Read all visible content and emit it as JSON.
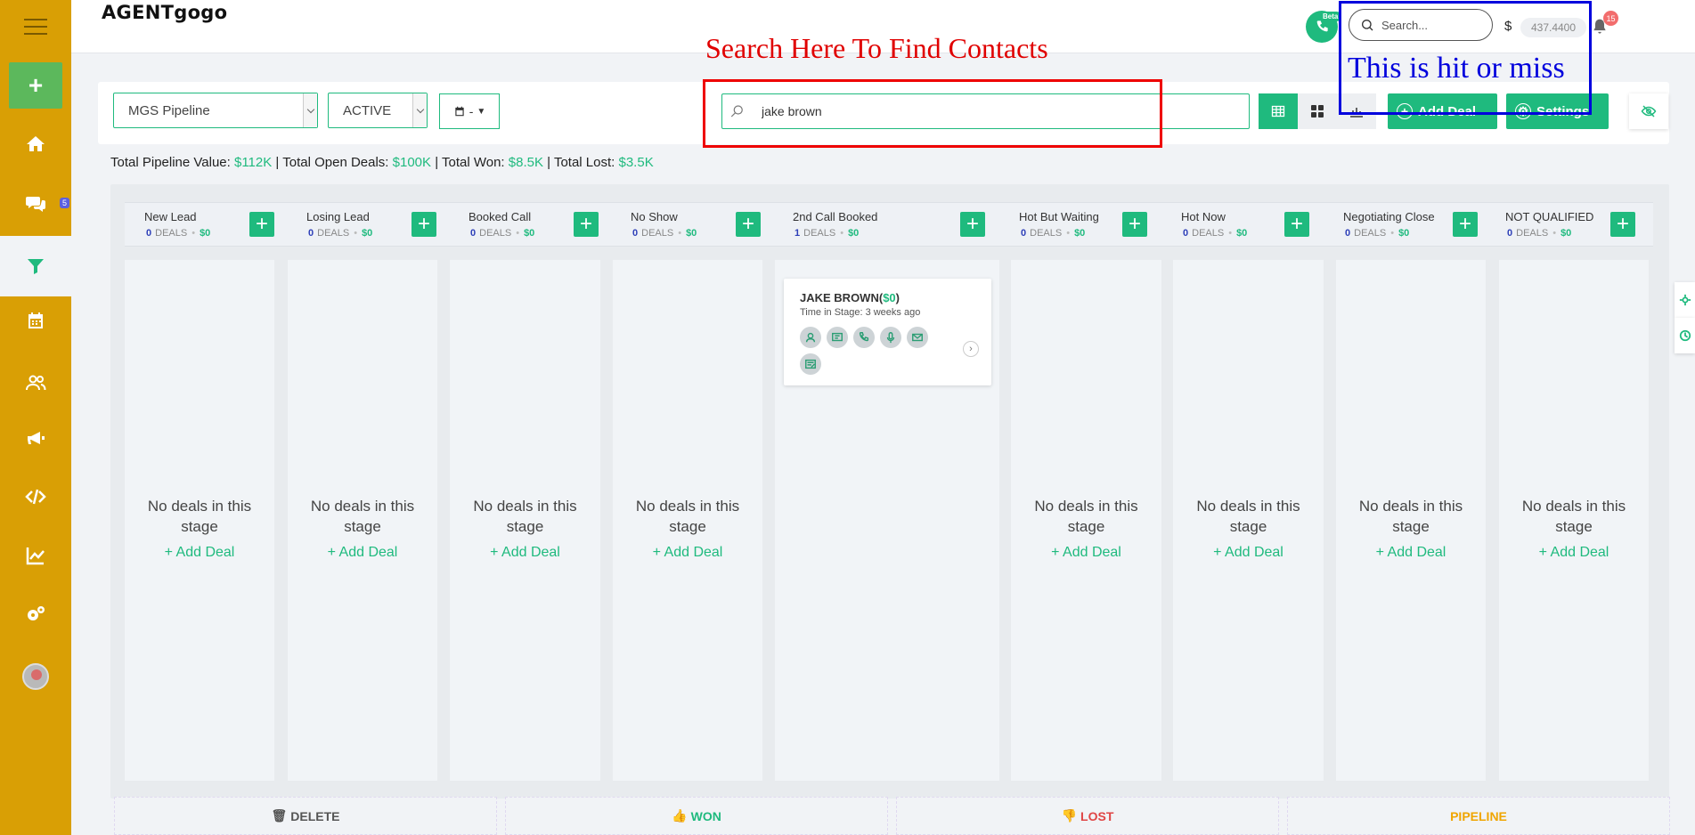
{
  "app": {
    "logo": "AGENTgogo"
  },
  "sidebar": {
    "items": [
      {
        "name": "menu",
        "icon": "hamburger-icon"
      },
      {
        "name": "add",
        "icon": "plus-icon",
        "label": "+"
      },
      {
        "name": "home",
        "icon": "home-icon"
      },
      {
        "name": "conversations",
        "icon": "chat-icon",
        "badge": "5"
      },
      {
        "name": "opportunities",
        "icon": "filter-icon",
        "active": true
      },
      {
        "name": "calendar",
        "icon": "calendar-icon"
      },
      {
        "name": "contacts",
        "icon": "users-icon"
      },
      {
        "name": "marketing",
        "icon": "megaphone-icon"
      },
      {
        "name": "sites",
        "icon": "code-icon"
      },
      {
        "name": "reporting",
        "icon": "chart-icon"
      },
      {
        "name": "settings",
        "icon": "gears-icon"
      },
      {
        "name": "profile",
        "icon": "avatar-icon"
      }
    ]
  },
  "header": {
    "phone_beta": "Beta",
    "search_placeholder": "Search...",
    "currency": "$",
    "balance": "437.4400",
    "notification_count": "15"
  },
  "filters": {
    "pipeline": "MGS Pipeline",
    "status": "ACTIVE",
    "date_label": "-",
    "search_value": "jake brown",
    "add_deal": "Add Deal",
    "settings": "Settings"
  },
  "totals": {
    "pipeline_label": "Total Pipeline Value:",
    "pipeline_value": "$112K",
    "open_label": "Total Open Deals:",
    "open_value": "$100K",
    "won_label": "Total Won:",
    "won_value": "$8.5K",
    "lost_label": "Total Lost:",
    "lost_value": "$3.5K",
    "sep": "|"
  },
  "board": {
    "deals_word": "DEALS",
    "empty_line1": "No deals in this",
    "empty_line2": "stage",
    "add_deal_link": "+ Add Deal",
    "stages": [
      {
        "name": "New Lead",
        "count": "0",
        "amount": "$0"
      },
      {
        "name": "Losing Lead",
        "count": "0",
        "amount": "$0"
      },
      {
        "name": "Booked Call",
        "count": "0",
        "amount": "$0"
      },
      {
        "name": "No Show",
        "count": "0",
        "amount": "$0"
      },
      {
        "name": "2nd Call Booked",
        "count": "1",
        "amount": "$0"
      },
      {
        "name": "Hot But Waiting",
        "count": "0",
        "amount": "$0"
      },
      {
        "name": "Hot Now",
        "count": "0",
        "amount": "$0"
      },
      {
        "name": "Negotiating Close",
        "count": "0",
        "amount": "$0"
      },
      {
        "name": "NOT QUALIFIED",
        "count": "0",
        "amount": "$0"
      }
    ],
    "deal_card": {
      "name": "JAKE BROWN",
      "value": "$0",
      "time_in_stage": "Time in Stage: 3 weeks ago"
    }
  },
  "bottom": {
    "delete": "DELETE",
    "won": "WON",
    "lost": "LOST",
    "pipeline": "PIPELINE"
  },
  "annotations": {
    "red_text": "Search Here To Find Contacts",
    "blue_text": "This is hit or miss"
  },
  "colors": {
    "sidebar": "#d99f05",
    "accent": "#1fba7e",
    "annotation_red": "#e00000",
    "annotation_blue": "#0000dd"
  }
}
